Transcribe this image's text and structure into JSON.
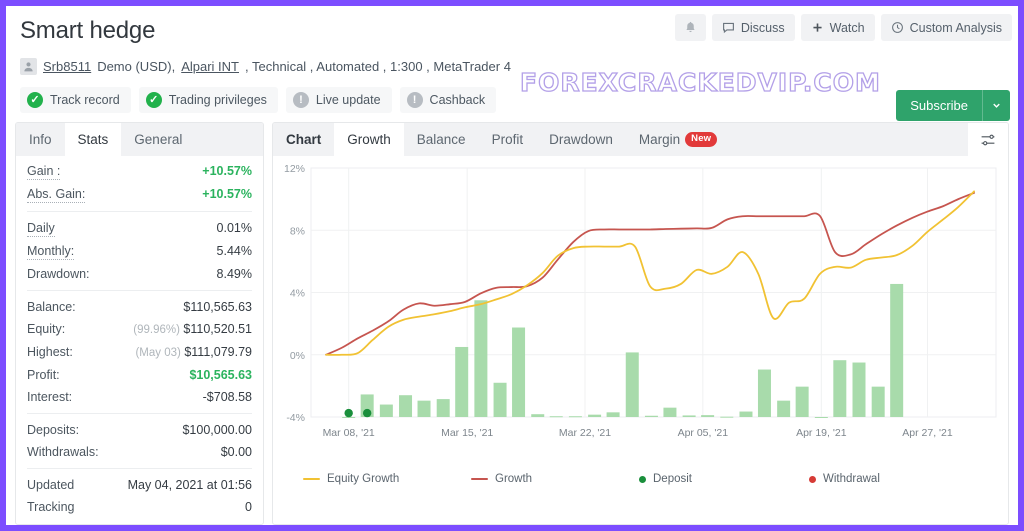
{
  "theme": {
    "page_border": "#7c4dff",
    "accent_green": "#2bb35e",
    "subscribe_green": "#2fa36b",
    "bar_green": "#a8dbab",
    "equity_yellow": "#f1c233",
    "growth_red": "#c6554f",
    "deposit_green": "#1a8f3c",
    "withdrawal_red": "#d63b36"
  },
  "header": {
    "title": "Smart hedge",
    "buttons": [
      {
        "name": "notifications",
        "label": "",
        "icon": "bell-icon"
      },
      {
        "name": "discuss",
        "label": "Discuss",
        "icon": "comment-icon"
      },
      {
        "name": "watch",
        "label": "Watch",
        "icon": "plus-icon"
      },
      {
        "name": "custom-analysis",
        "label": "Custom Analysis",
        "icon": "clock-icon"
      }
    ],
    "account": {
      "avatar_icon": "user-icon",
      "username": "Srb8511",
      "type": "Demo (USD),",
      "broker": "Alpari INT",
      "rest": ", Technical , Automated , 1:300 , MetaTrader 4"
    },
    "badges": [
      {
        "label": "Track record",
        "state": "ok"
      },
      {
        "label": "Trading privileges",
        "state": "ok"
      },
      {
        "label": "Live update",
        "state": "warn"
      },
      {
        "label": "Cashback",
        "state": "warn"
      }
    ],
    "watermark": "FOREXCRACKEDVIP.COM",
    "subscribe": {
      "label": "Subscribe",
      "caret_icon": "chevron-down-icon"
    }
  },
  "sidebar": {
    "tabs": [
      {
        "label": "Info",
        "active": false
      },
      {
        "label": "Stats",
        "active": true
      },
      {
        "label": "General",
        "active": false
      }
    ],
    "groups": [
      [
        {
          "key": "Gain :",
          "value": "+10.57%",
          "style": "green",
          "dotted": true
        },
        {
          "key": "Abs. Gain:",
          "value": "+10.57%",
          "style": "green",
          "dotted": true
        }
      ],
      [
        {
          "key": "Daily",
          "value": "0.01%",
          "style": "",
          "dotted": true
        },
        {
          "key": "Monthly:",
          "value": "5.44%",
          "style": "",
          "dotted": true
        },
        {
          "key": "Drawdown:",
          "value": "8.49%",
          "style": "",
          "dotted": false
        }
      ],
      [
        {
          "key": "Balance:",
          "value": "$110,565.63",
          "style": "",
          "dotted": false
        },
        {
          "key": "Equity:",
          "value": "$110,520.51",
          "prefix": "(99.96%)",
          "style": "",
          "dotted": false
        },
        {
          "key": "Highest:",
          "value": "$111,079.79",
          "prefix": "(May 03)",
          "style": "",
          "dotted": false
        },
        {
          "key": "Profit:",
          "value": "$10,565.63",
          "style": "bold",
          "dotted": false
        },
        {
          "key": "Interest:",
          "value": "-$708.58",
          "style": "",
          "dotted": false
        }
      ],
      [
        {
          "key": "Deposits:",
          "value": "$100,000.00",
          "style": "",
          "dotted": false
        },
        {
          "key": "Withdrawals:",
          "value": "$0.00",
          "style": "",
          "dotted": false
        }
      ],
      [
        {
          "key": "Updated",
          "value": "May 04, 2021 at 01:56",
          "style": "",
          "dotted": false
        },
        {
          "key": "Tracking",
          "value": "0",
          "style": "",
          "dotted": false
        }
      ]
    ]
  },
  "chart_panel": {
    "tabs": [
      {
        "label": "Chart",
        "active": false,
        "bold": true
      },
      {
        "label": "Growth",
        "active": true,
        "bold": false
      },
      {
        "label": "Balance",
        "active": false,
        "bold": false
      },
      {
        "label": "Profit",
        "active": false,
        "bold": false
      },
      {
        "label": "Drawdown",
        "active": false,
        "bold": false
      },
      {
        "label": "Margin",
        "active": false,
        "bold": false,
        "badge": "New"
      }
    ],
    "settings_icon": "sliders-icon"
  },
  "chart_data": {
    "type": "line",
    "title": "Growth",
    "xlabel": "",
    "ylabel": "",
    "ylim": [
      -4,
      12
    ],
    "yticks": [
      12,
      8,
      4,
      0,
      -4
    ],
    "ytick_labels": [
      "12%",
      "8%",
      "4%",
      "0%",
      "-4%"
    ],
    "xtick_labels": [
      "Mar 08, '21",
      "Mar 15, '21",
      "Mar 22, '21",
      "Apr 05, '21",
      "Apr 19, '21",
      "Apr 27, '21"
    ],
    "xtick_positions": [
      0.055,
      0.228,
      0.4,
      0.572,
      0.745,
      0.9
    ],
    "grid": true,
    "legend_position": "bottom",
    "legend": [
      {
        "name": "Equity Growth",
        "type": "line",
        "color": "#f1c233"
      },
      {
        "name": "Growth",
        "type": "line",
        "color": "#c6554f"
      },
      {
        "name": "Deposit",
        "type": "dot",
        "color": "#1a8f3c"
      },
      {
        "name": "Withdrawal",
        "type": "dot",
        "color": "#d63b36"
      }
    ],
    "series": [
      {
        "name": "Growth",
        "type": "line",
        "color": "#c6554f",
        "x": [
          0.022,
          0.045,
          0.068,
          0.09,
          0.113,
          0.135,
          0.158,
          0.18,
          0.203,
          0.225,
          0.248,
          0.27,
          0.293,
          0.315,
          0.338,
          0.36,
          0.383,
          0.405,
          0.428,
          0.45,
          0.473,
          0.495,
          0.518,
          0.54,
          0.563,
          0.585,
          0.608,
          0.63,
          0.653,
          0.675,
          0.698,
          0.72,
          0.743,
          0.765,
          0.788,
          0.81,
          0.833,
          0.855,
          0.878,
          0.9,
          0.923,
          0.945,
          0.968
        ],
        "values": [
          0.0,
          0.45,
          1.05,
          1.55,
          2.15,
          2.9,
          3.3,
          3.15,
          3.25,
          3.4,
          3.95,
          4.3,
          4.35,
          4.4,
          4.95,
          6.1,
          7.25,
          7.95,
          8.05,
          8.05,
          8.05,
          8.05,
          8.08,
          8.1,
          8.12,
          8.15,
          8.7,
          8.9,
          8.9,
          8.9,
          8.9,
          8.9,
          8.92,
          6.6,
          6.45,
          7.1,
          7.75,
          8.3,
          8.8,
          9.2,
          9.55,
          10.0,
          10.4
        ]
      },
      {
        "name": "Equity Growth",
        "type": "line",
        "color": "#f1c233",
        "x": [
          0.022,
          0.045,
          0.068,
          0.09,
          0.113,
          0.135,
          0.158,
          0.18,
          0.203,
          0.225,
          0.248,
          0.27,
          0.293,
          0.315,
          0.338,
          0.36,
          0.383,
          0.405,
          0.428,
          0.45,
          0.473,
          0.495,
          0.518,
          0.54,
          0.563,
          0.585,
          0.608,
          0.63,
          0.653,
          0.675,
          0.698,
          0.72,
          0.743,
          0.765,
          0.788,
          0.81,
          0.833,
          0.855,
          0.878,
          0.9,
          0.923,
          0.945,
          0.968
        ],
        "values": [
          0.0,
          0.0,
          0.1,
          0.95,
          1.8,
          2.25,
          2.45,
          2.6,
          2.8,
          3.05,
          3.25,
          3.55,
          3.9,
          4.45,
          5.25,
          6.35,
          6.85,
          6.95,
          6.95,
          6.95,
          6.95,
          4.4,
          4.25,
          4.55,
          5.45,
          5.2,
          5.65,
          6.6,
          5.2,
          2.35,
          3.35,
          3.6,
          5.2,
          5.65,
          5.6,
          6.1,
          6.25,
          6.4,
          7.0,
          7.9,
          8.7,
          9.5,
          10.5
        ]
      }
    ],
    "bars": {
      "name": "Daily Volume",
      "color": "#a8dbab",
      "x": [
        0.055,
        0.082,
        0.11,
        0.138,
        0.165,
        0.193,
        0.22,
        0.248,
        0.276,
        0.303,
        0.331,
        0.358,
        0.386,
        0.414,
        0.441,
        0.469,
        0.497,
        0.524,
        0.552,
        0.579,
        0.607,
        0.635,
        0.662,
        0.69,
        0.717,
        0.745,
        0.772,
        0.8,
        0.828,
        0.855,
        0.883,
        0.91,
        0.938,
        0.966
      ],
      "values": [
        0.0,
        1.45,
        0.8,
        1.4,
        1.05,
        1.15,
        4.5,
        7.5,
        2.2,
        5.75,
        0.18,
        0.05,
        0.05,
        0.15,
        0.3,
        4.15,
        0.08,
        0.6,
        0.1,
        0.12,
        0.02,
        0.35,
        3.05,
        1.05,
        1.95,
        0.0,
        3.65,
        3.5,
        1.95,
        8.55
      ],
      "baseline": -4
    },
    "markers": [
      {
        "type": "deposit",
        "x": 0.055,
        "y": -3.75,
        "color": "#1a8f3c"
      },
      {
        "type": "deposit",
        "x": 0.082,
        "y": -3.75,
        "color": "#1a8f3c"
      }
    ]
  }
}
